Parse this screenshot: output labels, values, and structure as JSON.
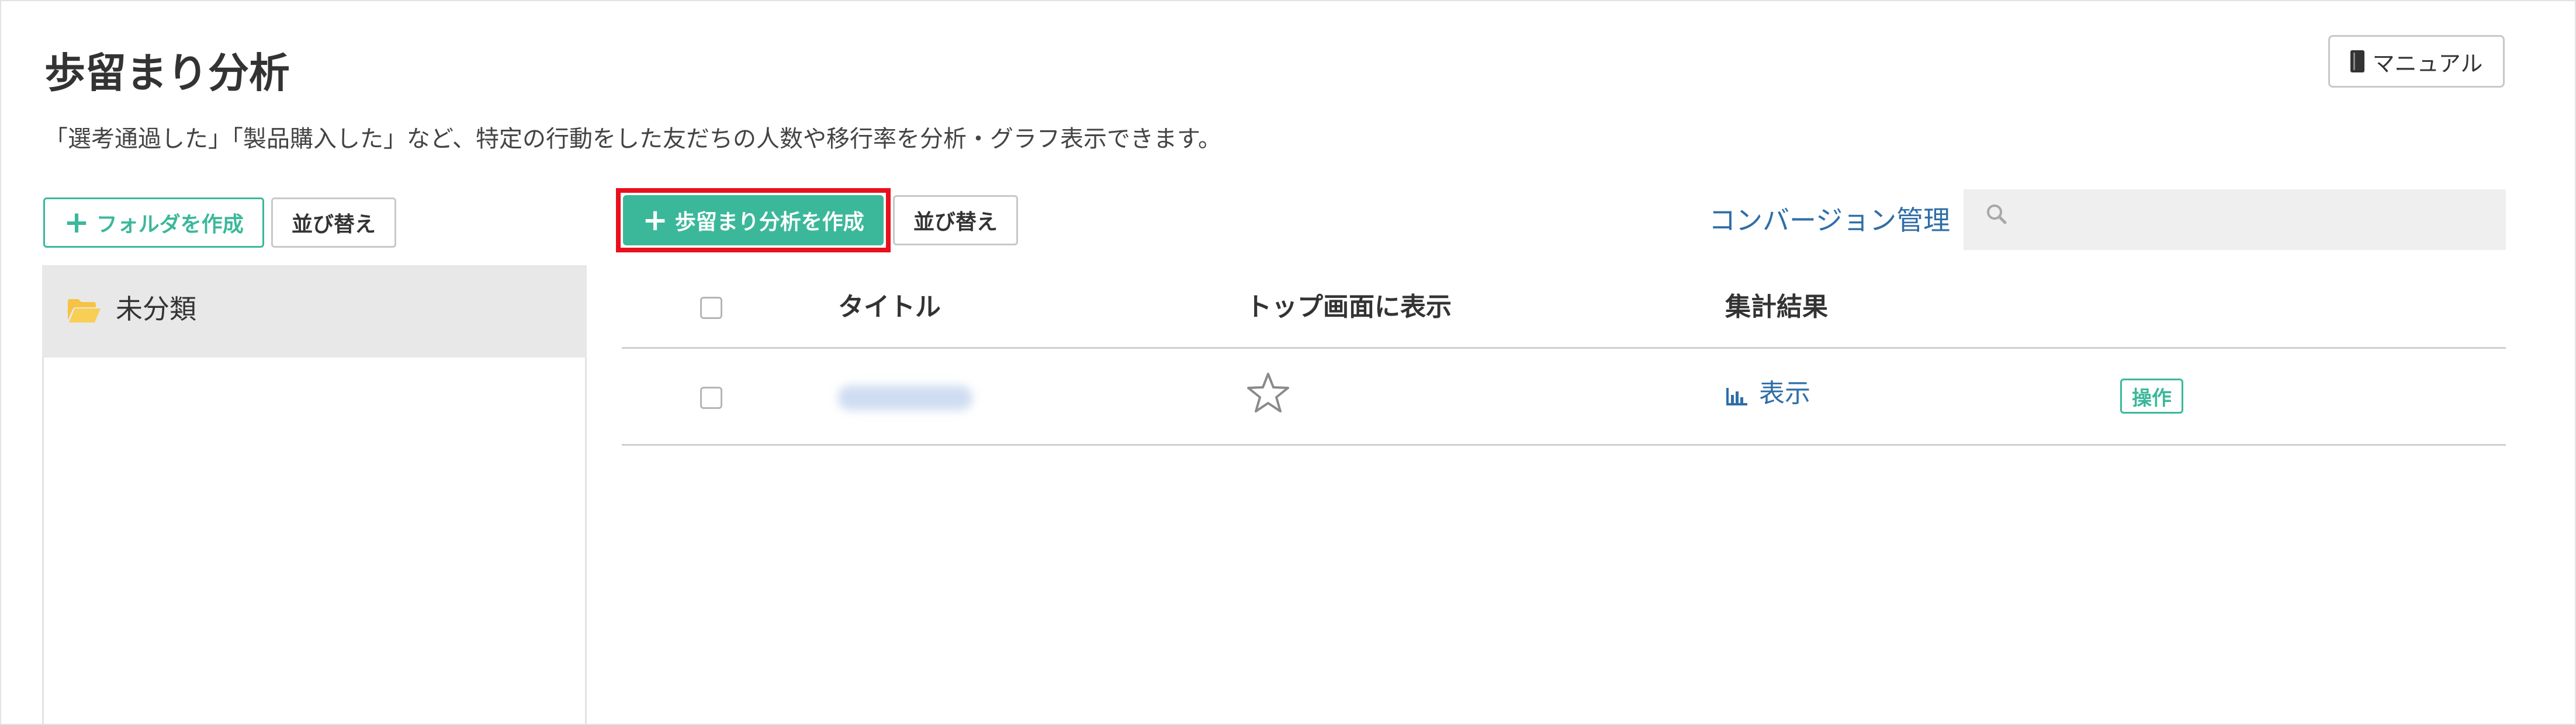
{
  "header": {
    "title": "歩留まり分析",
    "description": "「選考通過した」「製品購入した」など、特定の行動をした友だちの人数や移行率を分析・グラフ表示できます。",
    "manual_label": "マニュアル",
    "manual_icon": "book-icon"
  },
  "sidebar": {
    "create_folder_label": "フォルダを作成",
    "sort_label": "並び替え",
    "folders": [
      {
        "label": "未分類",
        "icon": "folder-open-icon"
      }
    ]
  },
  "toolbar": {
    "create_label": "歩留まり分析を作成",
    "sort_label": "並び替え",
    "conversion_link": "コンバージョン管理",
    "search_placeholder": ""
  },
  "table": {
    "headers": {
      "title": "タイトル",
      "show_on_top": "トップ画面に表示",
      "result": "集計結果"
    },
    "rows": [
      {
        "title": "",
        "starred": false,
        "result_link": "表示",
        "operation": "操作"
      }
    ]
  },
  "colors": {
    "accent_green": "#3bb89a",
    "link_blue": "#2e6ea8",
    "highlight_red": "#e8101c"
  }
}
